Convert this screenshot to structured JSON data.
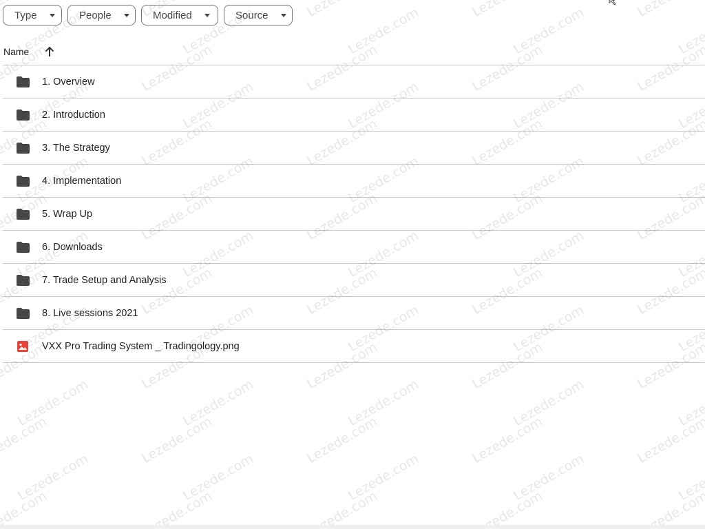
{
  "filters": {
    "type_label": "Type",
    "people_label": "People",
    "modified_label": "Modified",
    "source_label": "Source"
  },
  "header": {
    "name_label": "Name",
    "sort_icon": "arrow-up-icon"
  },
  "files": [
    {
      "name": "1. Overview",
      "icon": "folder-icon"
    },
    {
      "name": "2. Introduction",
      "icon": "folder-icon"
    },
    {
      "name": "3. The Strategy",
      "icon": "folder-icon"
    },
    {
      "name": "4. Implementation",
      "icon": "folder-icon"
    },
    {
      "name": "5. Wrap Up",
      "icon": "folder-icon"
    },
    {
      "name": "6. Downloads",
      "icon": "folder-icon"
    },
    {
      "name": "7. Trade Setup and Analysis",
      "icon": "folder-icon"
    },
    {
      "name": "8. Live sessions 2021",
      "icon": "folder-icon"
    },
    {
      "name": "VXX Pro Trading System _ Tradingology.png",
      "icon": "image-file-icon"
    }
  ],
  "watermark_text": "Lezede.com",
  "colors": {
    "folder": "#444746",
    "image_file": "#e94235",
    "divider": "#c7c7c7",
    "chip_border": "#747775"
  }
}
